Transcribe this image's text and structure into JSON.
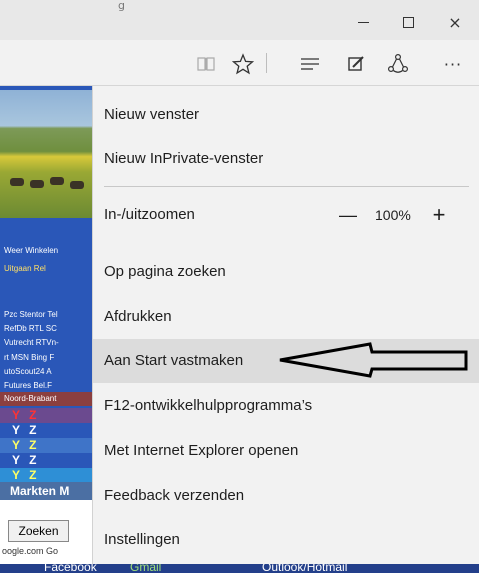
{
  "window": {
    "caption_text": "g",
    "minimize_icon": "minimize-icon",
    "maximize_icon": "maximize-icon",
    "close_icon": "close-icon",
    "close_glyph": "×"
  },
  "toolbar": {
    "icons": [
      "reading-view-icon",
      "favorite-star-icon",
      "hub-icon",
      "web-note-icon",
      "share-icon",
      "more-actions-icon"
    ],
    "more_glyph": "···"
  },
  "background_page": {
    "link_rows": [
      "Weer  Winkelen",
      "Uitgaan  Rel",
      "Pzc Stentor Tel",
      "RefDb RTL SC",
      "Vutrecht RTVn-",
      "rt MSN Bing F",
      "utoScout24  A",
      "Futures  Bel.F",
      "Noord-Brabant"
    ],
    "yz_rows": [
      "Y Z",
      "Y Z",
      "Y Z",
      "Y Z",
      "Y Z"
    ],
    "markten": "Markten  M",
    "search_button": "Zoeken",
    "google_text": "oogle.com  Go",
    "bottom_links": [
      "Facebook",
      "Gmail",
      "Outlook/Hotmail"
    ]
  },
  "menu": {
    "new_window": "Nieuw venster",
    "new_inprivate": "Nieuw InPrivate-venster",
    "zoom_label": "In-/uitzoomen",
    "zoom_minus": "—",
    "zoom_value": "100%",
    "zoom_plus": "+",
    "find_on_page": "Op pagina zoeken",
    "print": "Afdrukken",
    "pin_to_start": "Aan Start vastmaken",
    "f12_tools": "F12-ontwikkelhulpprogramma’s",
    "open_ie": "Met Internet Explorer openen",
    "send_feedback": "Feedback verzenden",
    "settings": "Instellingen"
  },
  "colors": {
    "menu_bg": "#f2f2f2",
    "menu_highlight": "#dcdcdc",
    "page_blue": "#2a57b8",
    "yz_yellow": "#ffff66",
    "yz_red": "#ff3333"
  }
}
